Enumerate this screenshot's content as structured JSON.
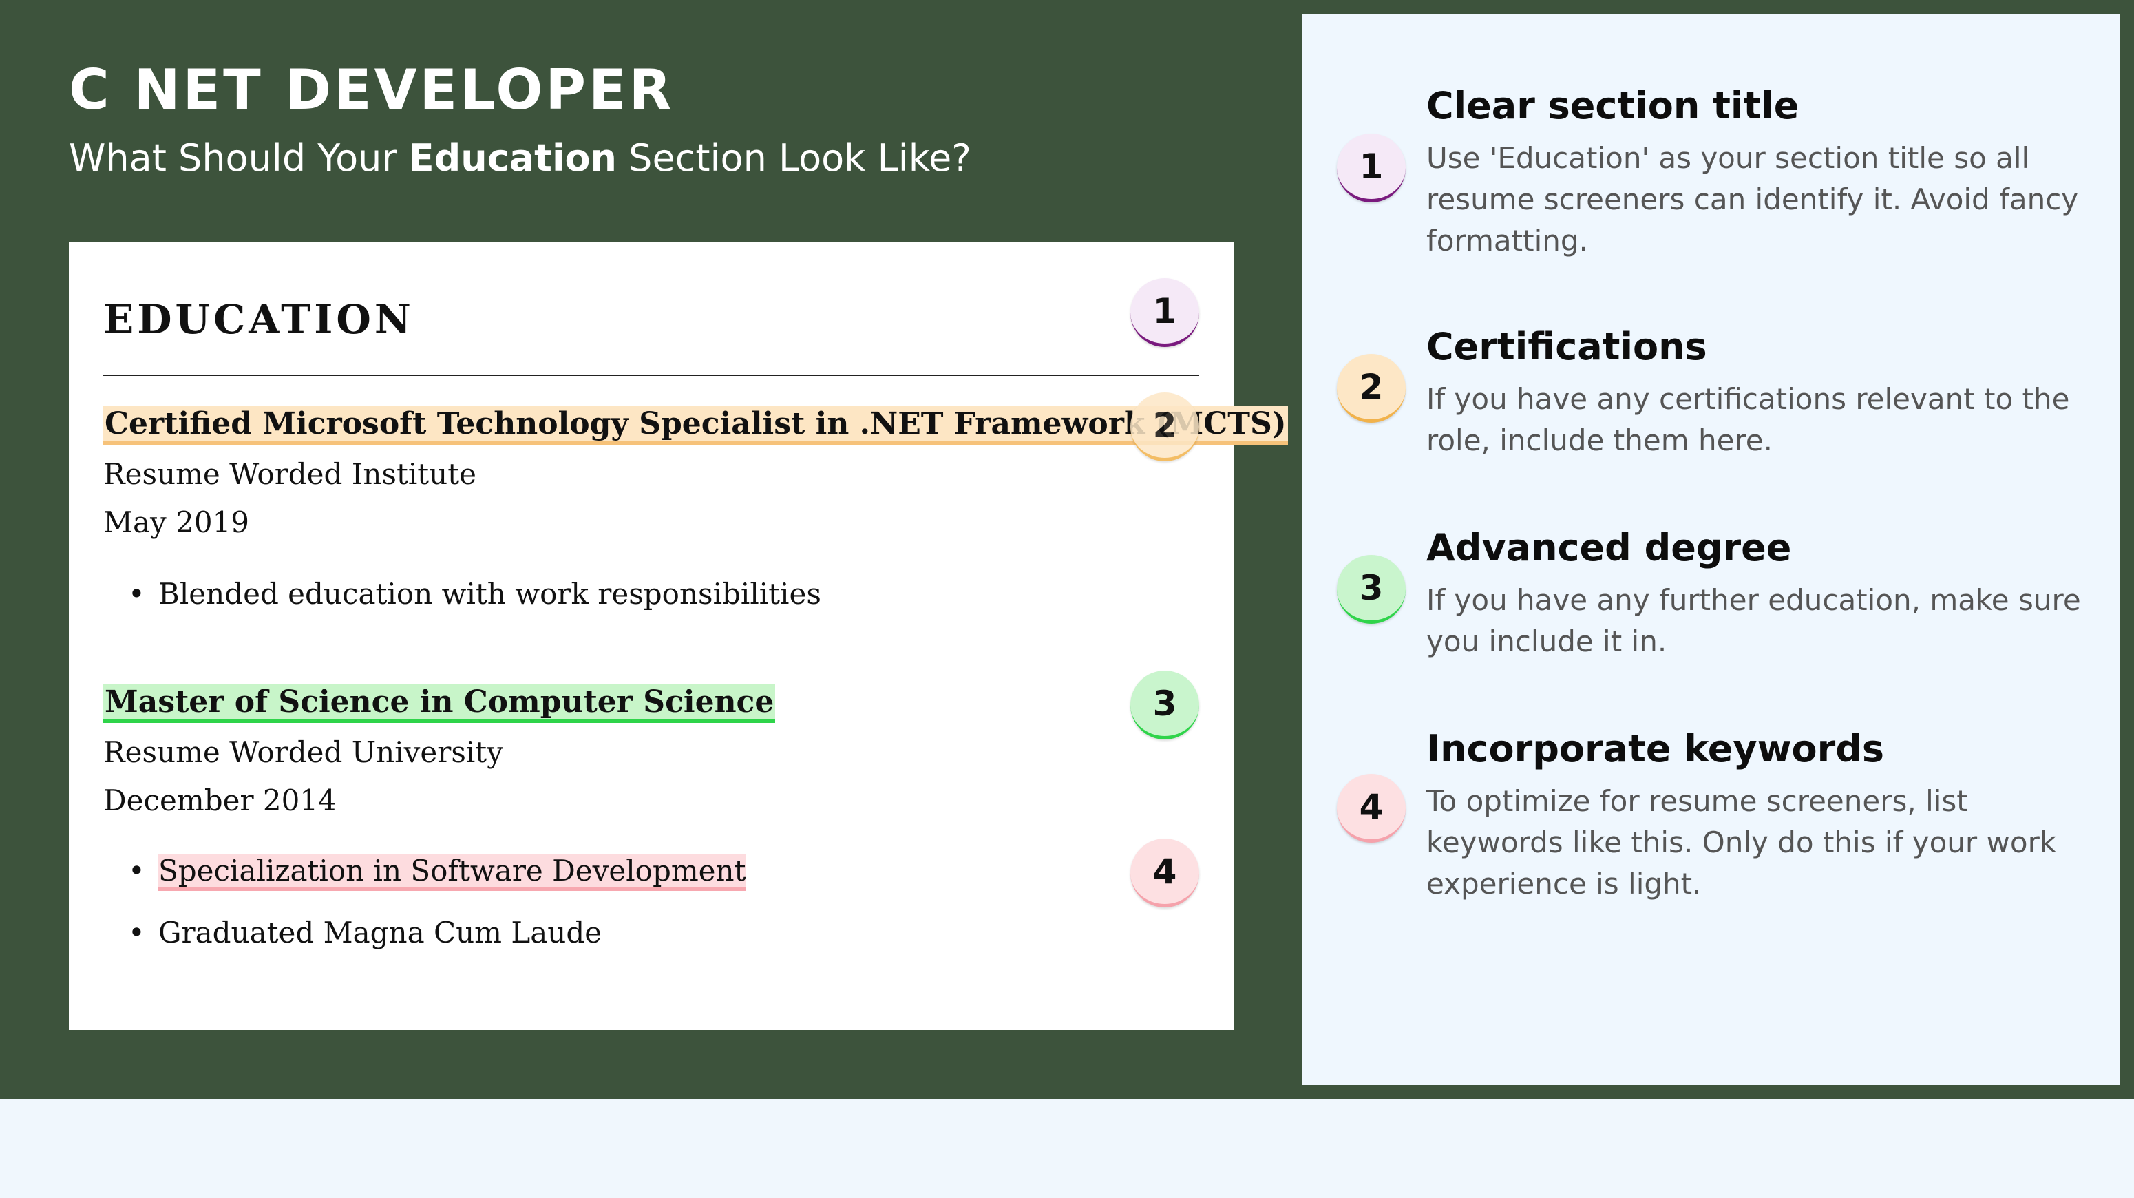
{
  "header": {
    "title": "C NET DEVELOPER",
    "subtitle_before": "What Should Your ",
    "subtitle_strong": "Education",
    "subtitle_after": " Section Look Like?"
  },
  "resume": {
    "section_heading": "EDUCATION",
    "entries": [
      {
        "degree": "Certified Microsoft Technology Specialist in .NET Framework (MCTS)",
        "institution": "Resume Worded Institute",
        "date": "May 2019",
        "bullets": [
          "Blended education with work responsibilities"
        ]
      },
      {
        "degree": "Master of Science in Computer Science",
        "institution": "Resume Worded University",
        "date": "December 2014",
        "bullets": [
          "Specialization in Software Development",
          "Graduated Magna Cum Laude"
        ]
      }
    ],
    "badges": [
      "1",
      "2",
      "3",
      "4"
    ]
  },
  "tips": [
    {
      "number": "1",
      "title": "Clear section title",
      "text": "Use 'Education' as your section title so all resume screeners can identify it. Avoid fancy formatting."
    },
    {
      "number": "2",
      "title": "Certifications",
      "text": "If you have any certifications relevant to the role, include them here."
    },
    {
      "number": "3",
      "title": "Advanced degree",
      "text": "If you have any further education, make sure you include it in."
    },
    {
      "number": "4",
      "title": "Incorporate keywords",
      "text": "To optimize for resume screeners, list keywords like this. Only do this if your work experience is light."
    }
  ],
  "colors": {
    "background_green": "#3d533c",
    "panel": "#eff7fe",
    "badge1": "#7a1a7e",
    "badge2": "#f1b24b",
    "badge3": "#2fd44a",
    "badge4": "#f5a2ab"
  }
}
